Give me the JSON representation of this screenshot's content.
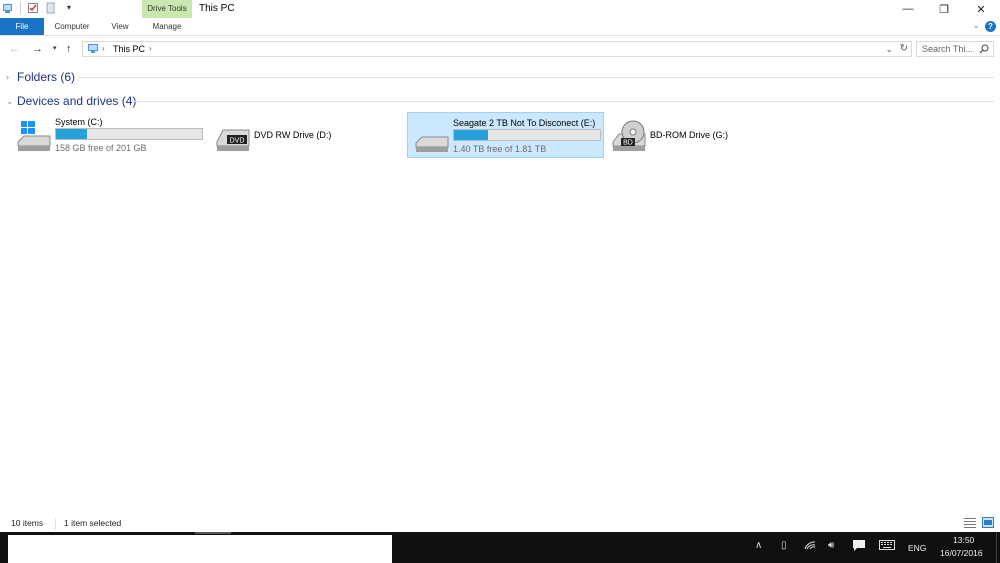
{
  "window": {
    "title": "This PC",
    "context_tab": "Drive Tools",
    "controls": {
      "minimize": "—",
      "restore": "❐",
      "close": "✕"
    }
  },
  "ribbon": {
    "tabs": [
      {
        "label": "File"
      },
      {
        "label": "Computer"
      },
      {
        "label": "View"
      },
      {
        "label": "Manage"
      }
    ],
    "help": "?"
  },
  "address": {
    "path": "This PC",
    "search_placeholder": "Search Thi..."
  },
  "groups": [
    {
      "label": "Folders (6)",
      "expanded": false
    },
    {
      "label": "Devices and drives (4)",
      "expanded": true
    }
  ],
  "drives": [
    {
      "name": "System (C:)",
      "free": "158 GB free of 201 GB",
      "used_fraction": 0.21,
      "icon": "windows-drive-icon",
      "selected": false
    },
    {
      "name": "DVD RW Drive (D:)",
      "icon": "dvd-drive-icon",
      "badge": "DVD",
      "selected": false
    },
    {
      "name": "Seagate 2 TB Not To Disconect (E:)",
      "free": "1.40 TB free of 1.81 TB",
      "used_fraction": 0.23,
      "icon": "hard-drive-icon",
      "selected": true
    },
    {
      "name": "BD-ROM Drive (G:)",
      "icon": "bd-drive-icon",
      "badge": "BD",
      "selected": false
    }
  ],
  "status": {
    "items": "10 items",
    "selected": "1 item selected"
  },
  "taskbar": {
    "language": "ENG",
    "time": "13:50",
    "date": "16/07/2016"
  },
  "colors": {
    "accent": "#1a73c7",
    "selection": "#cce8ff",
    "bar_fill": "#26a0da",
    "group_header": "#1e3287"
  }
}
